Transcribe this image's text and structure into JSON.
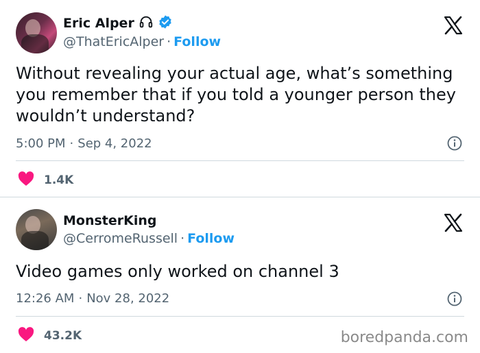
{
  "tweets": [
    {
      "name": "Eric Alper",
      "handle": "@ThatEricAlper",
      "follow": "Follow",
      "separator": "·",
      "text": "Without revealing your actual age, what’s something you remember that if you told a younger person they wouldn’t understand?",
      "time": "5:00 PM",
      "date": "Sep 4, 2022",
      "likes": "1.4K"
    },
    {
      "name": "MonsterKing",
      "handle": "@CerromeRussell",
      "follow": "Follow",
      "separator": "·",
      "text": "Video games only worked on channel 3",
      "time": "12:26 AM",
      "date": "Nov 28, 2022",
      "likes": "43.2K"
    }
  ],
  "watermark": "boredpanda.com",
  "colors": {
    "follow_blue": "#1d9bf0",
    "verified_blue": "#1d9bf0",
    "heart_pink": "#f91880",
    "muted_text": "#536471"
  },
  "icons": [
    "headphones-icon",
    "verified-badge-icon",
    "x-logo-icon",
    "info-icon",
    "heart-icon"
  ]
}
